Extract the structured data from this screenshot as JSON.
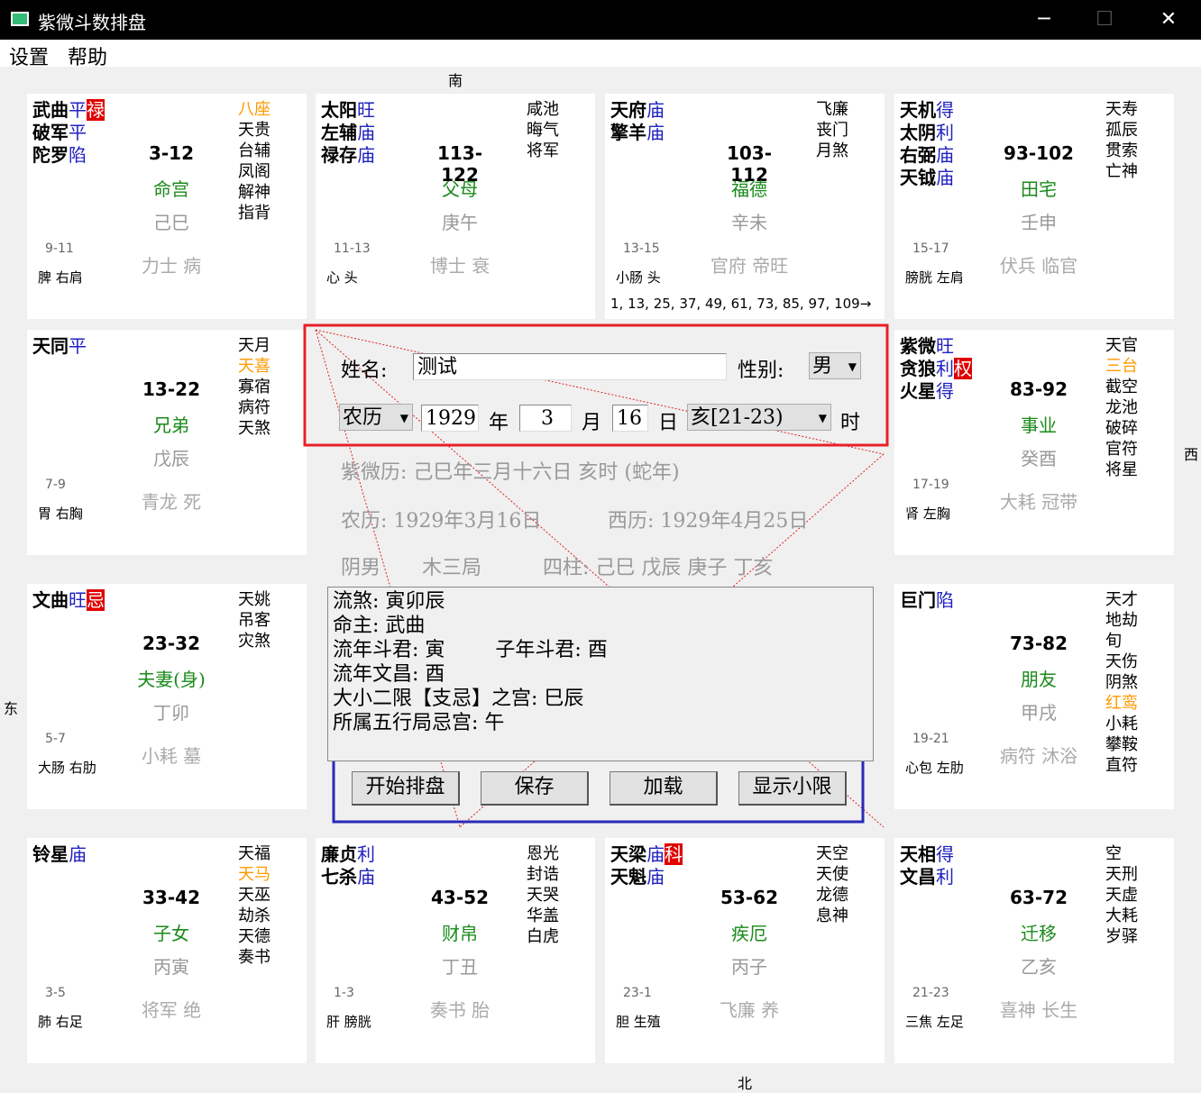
{
  "window": {
    "title": "紫微斗数排盘",
    "minimize": "─",
    "maximize": "☐",
    "close": "✕"
  },
  "menu": [
    "设置",
    "帮助"
  ],
  "compass": {
    "south": "南",
    "north": "北",
    "east": "东",
    "west": "西"
  },
  "palaces": [
    {
      "main": [
        {
          "name": "武曲",
          "b": "平",
          "hua": "禄"
        },
        {
          "name": "破军",
          "b": "平"
        },
        {
          "name": "陀罗",
          "b": "陷"
        }
      ],
      "minor": [
        {
          "t": "八座",
          "c": "orange"
        },
        {
          "t": "天贵"
        },
        {
          "t": "台辅"
        },
        {
          "t": "凤阁"
        },
        {
          "t": "解神"
        },
        {
          "t": "指背"
        }
      ],
      "range": "3-12",
      "name": "命宫",
      "gz": "己巳",
      "age": "9-11",
      "organ": "脾 右肩",
      "gods": "力士 病"
    },
    {
      "main": [
        {
          "name": "太阳",
          "b": "旺"
        },
        {
          "name": "左辅",
          "b": "庙"
        },
        {
          "name": "禄存",
          "b": "庙"
        }
      ],
      "minor": [
        {
          "t": "咸池"
        },
        {
          "t": "晦气"
        },
        {
          "t": "将军"
        }
      ],
      "range": "113-122",
      "name": "父母",
      "gz": "庚午",
      "age": "11-13",
      "organ": "心 头",
      "gods": "博士 衰"
    },
    {
      "main": [
        {
          "name": "天府",
          "b": "庙"
        },
        {
          "name": "擎羊",
          "b": "庙"
        }
      ],
      "minor": [
        {
          "t": "飞廉"
        },
        {
          "t": "丧门"
        },
        {
          "t": "月煞"
        }
      ],
      "range": "103-112",
      "name": "福德",
      "gz": "辛未",
      "age": "13-15",
      "organ": "小肠 头",
      "gods": "官府 帝旺",
      "flow": "1, 13, 25, 37, 49, 61, 73, 85, 97, 109→"
    },
    {
      "main": [
        {
          "name": "天机",
          "b": "得"
        },
        {
          "name": "太阴",
          "b": "利"
        },
        {
          "name": "右弼",
          "b": "庙"
        },
        {
          "name": "天钺",
          "b": "庙"
        }
      ],
      "minor": [
        {
          "t": "天寿"
        },
        {
          "t": "孤辰"
        },
        {
          "t": "贯索"
        },
        {
          "t": "亡神"
        }
      ],
      "range": "93-102",
      "name": "田宅",
      "gz": "壬申",
      "age": "15-17",
      "organ": "膀胱 左肩",
      "gods": "伏兵 临官"
    },
    {
      "main": [
        {
          "name": "天同",
          "b": "平"
        }
      ],
      "minor": [
        {
          "t": "天月"
        },
        {
          "t": "天喜",
          "c": "orange"
        },
        {
          "t": "寡宿"
        },
        {
          "t": "病符"
        },
        {
          "t": "天煞"
        }
      ],
      "range": "13-22",
      "name": "兄弟",
      "gz": "戊辰",
      "age": "7-9",
      "organ": "胃 右胸",
      "gods": "青龙 死"
    },
    {
      "main": [
        {
          "name": "紫微",
          "b": "旺"
        },
        {
          "name": "贪狼",
          "b": "利",
          "hua": "权"
        },
        {
          "name": "火星",
          "b": "得"
        }
      ],
      "minor": [
        {
          "t": "天官"
        },
        {
          "t": "三台",
          "c": "orange"
        },
        {
          "t": "截空"
        },
        {
          "t": "龙池"
        },
        {
          "t": "破碎"
        },
        {
          "t": "官符"
        },
        {
          "t": "将星"
        }
      ],
      "range": "83-92",
      "name": "事业",
      "gz": "癸酉",
      "age": "17-19",
      "organ": "肾 左胸",
      "gods": "大耗 冠带"
    },
    {
      "main": [
        {
          "name": "文曲",
          "b": "旺",
          "hua": "忌"
        }
      ],
      "minor": [
        {
          "t": "天姚"
        },
        {
          "t": "吊客"
        },
        {
          "t": "灾煞"
        }
      ],
      "range": "23-32",
      "name": "夫妻(身)",
      "gz": "丁卯",
      "age": "5-7",
      "organ": "大肠 右肋",
      "gods": "小耗 墓"
    },
    {
      "main": [
        {
          "name": "巨门",
          "b": "陷"
        }
      ],
      "minor": [
        {
          "t": "天才"
        },
        {
          "t": "地劫"
        },
        {
          "t": "旬"
        },
        {
          "t": "天伤"
        },
        {
          "t": "阴煞"
        },
        {
          "t": "红鸾",
          "c": "orange"
        },
        {
          "t": "小耗"
        },
        {
          "t": "攀鞍"
        },
        {
          "t": "直符"
        }
      ],
      "range": "73-82",
      "name": "朋友",
      "gz": "甲戌",
      "age": "19-21",
      "organ": "心包 左肋",
      "gods": "病符 沐浴"
    },
    {
      "main": [
        {
          "name": "铃星",
          "b": "庙"
        }
      ],
      "minor": [
        {
          "t": "天福"
        },
        {
          "t": "天马",
          "c": "orange"
        },
        {
          "t": "天巫"
        },
        {
          "t": "劫杀"
        },
        {
          "t": "天德"
        },
        {
          "t": "奏书"
        }
      ],
      "range": "33-42",
      "name": "子女",
      "gz": "丙寅",
      "age": "3-5",
      "organ": "肺 右足",
      "gods": "将军 绝"
    },
    {
      "main": [
        {
          "name": "廉贞",
          "b": "利"
        },
        {
          "name": "七杀",
          "b": "庙"
        }
      ],
      "minor": [
        {
          "t": "恩光"
        },
        {
          "t": "封诰"
        },
        {
          "t": "天哭"
        },
        {
          "t": "华盖"
        },
        {
          "t": "白虎"
        }
      ],
      "range": "43-52",
      "name": "财帛",
      "gz": "丁丑",
      "age": "1-3",
      "organ": "肝 膀胱",
      "gods": "奏书 胎"
    },
    {
      "main": [
        {
          "name": "天梁",
          "b": "庙",
          "hua": "科"
        },
        {
          "name": "天魁",
          "b": "庙"
        }
      ],
      "minor": [
        {
          "t": "天空"
        },
        {
          "t": "天使"
        },
        {
          "t": "龙德"
        },
        {
          "t": "息神"
        }
      ],
      "range": "53-62",
      "name": "疾厄",
      "gz": "丙子",
      "age": "23-1",
      "organ": "胆 生殖",
      "gods": "飞廉 养"
    },
    {
      "main": [
        {
          "name": "天相",
          "b": "得"
        },
        {
          "name": "文昌",
          "b": "利"
        }
      ],
      "minor": [
        {
          "t": "空"
        },
        {
          "t": "天刑"
        },
        {
          "t": "天虚"
        },
        {
          "t": "大耗"
        },
        {
          "t": "岁驿"
        }
      ],
      "range": "63-72",
      "name": "迁移",
      "gz": "乙亥",
      "age": "21-23",
      "organ": "三焦 左足",
      "gods": "喜神 长生"
    }
  ],
  "form": {
    "name_label": "姓名:",
    "name_value": "测试",
    "gender_label": "性别:",
    "gender_value": "男",
    "calendar_value": "农历",
    "year_value": "1929",
    "year_label": "年",
    "month_value": "3",
    "month_label": "月",
    "day_value": "16",
    "day_label": "日",
    "hour_value": "亥[21-23)",
    "hour_label": "时"
  },
  "summary": {
    "ziwei": "紫微历: 己巳年三月十六日 亥时 (蛇年)",
    "lunar": "农历: 1929年3月16日",
    "solar": "西历: 1929年4月25日",
    "yinyang": "阴男",
    "ju": "木三局",
    "pillars": "四柱: 己巳 戊辰 庚子 丁亥"
  },
  "info_lines": [
    "流煞: 寅卯辰",
    "命主: 武曲",
    "流年斗君: 寅        子年斗君: 酉",
    "流年文昌: 酉",
    "大小二限【支忌】之宫: 巳辰",
    "所属五行局忌宫: 午"
  ],
  "buttons": {
    "start": "开始排盘",
    "save": "保存",
    "load": "加载",
    "show": "显示小限"
  },
  "colors": {
    "main_star": "#000000",
    "brightness": "#2020c0",
    "hua_bg": "#e00000",
    "palace_name": "#1a8a1a",
    "orange": "#ff9900",
    "red_box": "#e8202a",
    "blue_box": "#2a2ab8"
  }
}
